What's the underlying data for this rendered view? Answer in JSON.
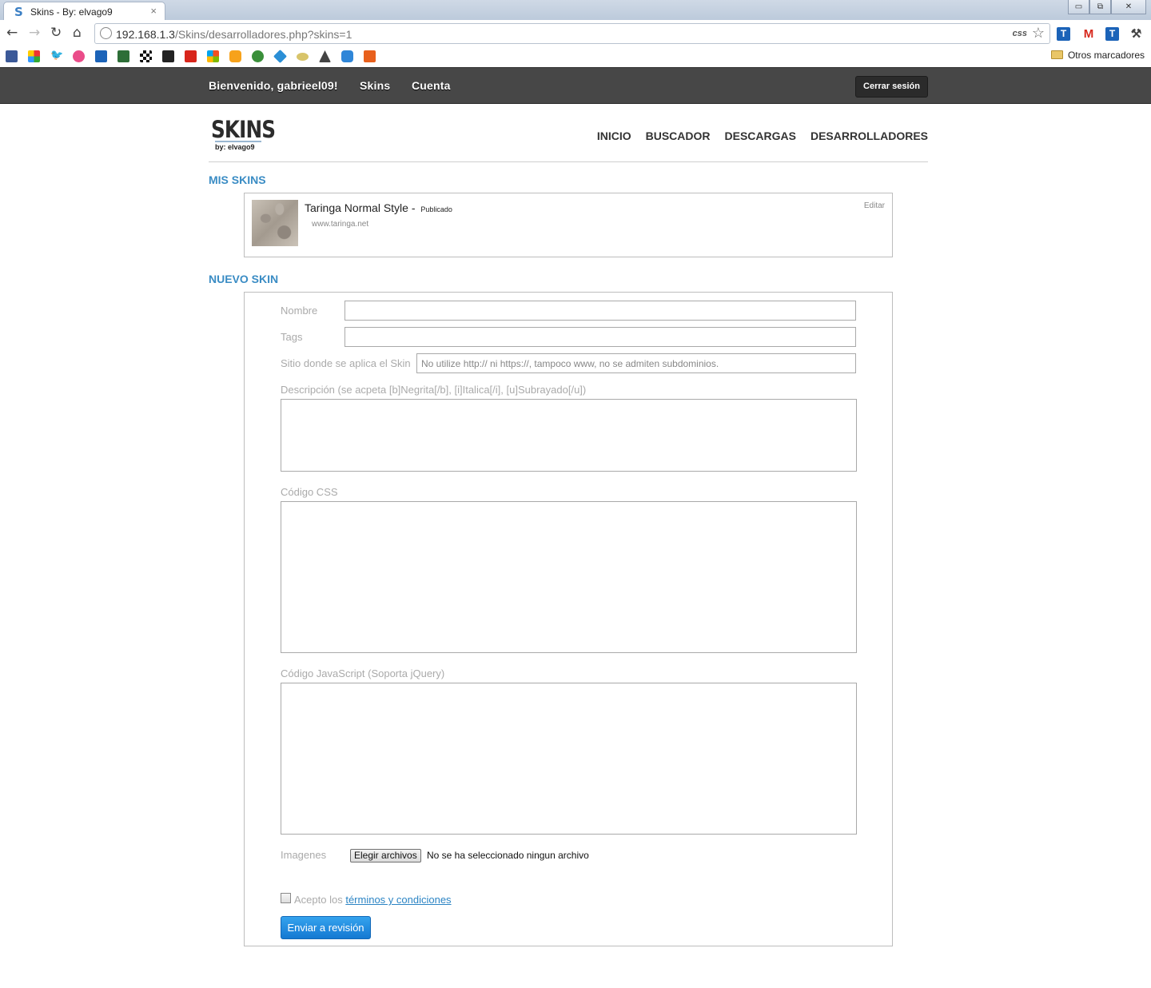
{
  "browser": {
    "tab_title": "Skins - By: elvago9",
    "tab_favicon": "S",
    "tab_close": "×",
    "url_host": "192.168.1.3",
    "url_path": "/Skins/desarrolladores.php?skins=1",
    "css_badge": "css",
    "other_bookmarks": "Otros marcadores",
    "window_controls": {
      "minimize": "▭",
      "restore": "⧉",
      "close": "✕"
    },
    "nav": {
      "back": "←",
      "forward": "→",
      "reload": "↻",
      "home": "⌂",
      "star": "☆"
    }
  },
  "site_bar": {
    "welcome": "Bienvenido, gabrieel09!",
    "skins_link": "Skins",
    "account_link": "Cuenta",
    "logout_button": "Cerrar sesión"
  },
  "brand": {
    "logo": "SKINS",
    "byline": "by: elvago9"
  },
  "main_nav": [
    "INICIO",
    "BUSCADOR",
    "DESCARGAS",
    "DESARROLLADORES"
  ],
  "my_skins": {
    "title": "MIS SKINS",
    "items": [
      {
        "name": "Taringa Normal Style",
        "separator": " - ",
        "status": "Publicado",
        "site": "www.taringa.net",
        "edit": "Editar"
      }
    ]
  },
  "new_skin": {
    "title": "NUEVO SKIN",
    "name_label": "Nombre",
    "tags_label": "Tags",
    "site_label": "Sitio donde se aplica el Skin",
    "site_placeholder": "No utilize http:// ni https://, tampoco www, no se admiten subdominios.",
    "description_label": "Descripción (se acpeta [b]Negrita[/b], [i]Italica[/i], [u]Subrayado[/u])",
    "css_label": "Código CSS",
    "js_label": "Código JavaScript (Soporta jQuery)",
    "images_label": "Imagenes",
    "file_button": "Elegir archivos",
    "file_status": "No se ha seleccionado ningun archivo",
    "accept_prefix": "Acepto los ",
    "terms_link": "términos y condiciones",
    "submit_button": "Enviar a revisión"
  },
  "colors": {
    "accent": "#3a8cc4",
    "site_bar": "#474747",
    "submit": "#1a88e0"
  }
}
